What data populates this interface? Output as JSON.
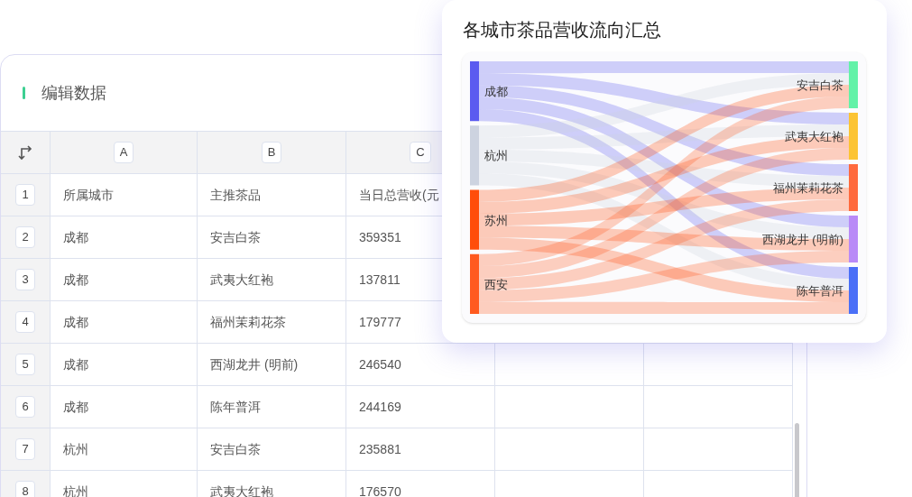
{
  "editor": {
    "title": "编辑数据",
    "columns": [
      "A",
      "B",
      "C"
    ],
    "rows": [
      {
        "number": "1",
        "cells": [
          "所属城市",
          "主推茶品",
          "当日总营收(元"
        ]
      },
      {
        "number": "2",
        "cells": [
          "成都",
          "安吉白茶",
          "359351"
        ]
      },
      {
        "number": "3",
        "cells": [
          "成都",
          "武夷大红袍",
          "137811"
        ]
      },
      {
        "number": "4",
        "cells": [
          "成都",
          "福州茉莉花茶",
          "179777"
        ]
      },
      {
        "number": "5",
        "cells": [
          "成都",
          "西湖龙井 (明前)",
          "246540"
        ]
      },
      {
        "number": "6",
        "cells": [
          "成都",
          "陈年普洱",
          "244169"
        ]
      },
      {
        "number": "7",
        "cells": [
          "杭州",
          "安吉白茶",
          "235881"
        ]
      },
      {
        "number": "8",
        "cells": [
          "杭州",
          "武夷大红袍",
          "176570"
        ]
      }
    ]
  },
  "chart": {
    "title": "各城市茶品营收流向汇总",
    "sources": [
      {
        "label": "成都",
        "color": "#5b5bf0"
      },
      {
        "label": "杭州",
        "color": "#cdd3e0"
      },
      {
        "label": "苏州",
        "color": "#ff4d0a"
      },
      {
        "label": "西安",
        "color": "#ff5a1f"
      }
    ],
    "targets": [
      {
        "label": "安吉白茶",
        "color": "#63f2a8"
      },
      {
        "label": "武夷大红袍",
        "color": "#fcc433"
      },
      {
        "label": "福州茉莉花茶",
        "color": "#ff6a3d"
      },
      {
        "label": "西湖龙井 (明前)",
        "color": "#b98af7"
      },
      {
        "label": "陈年普洱",
        "color": "#4a6ff7"
      }
    ]
  }
}
